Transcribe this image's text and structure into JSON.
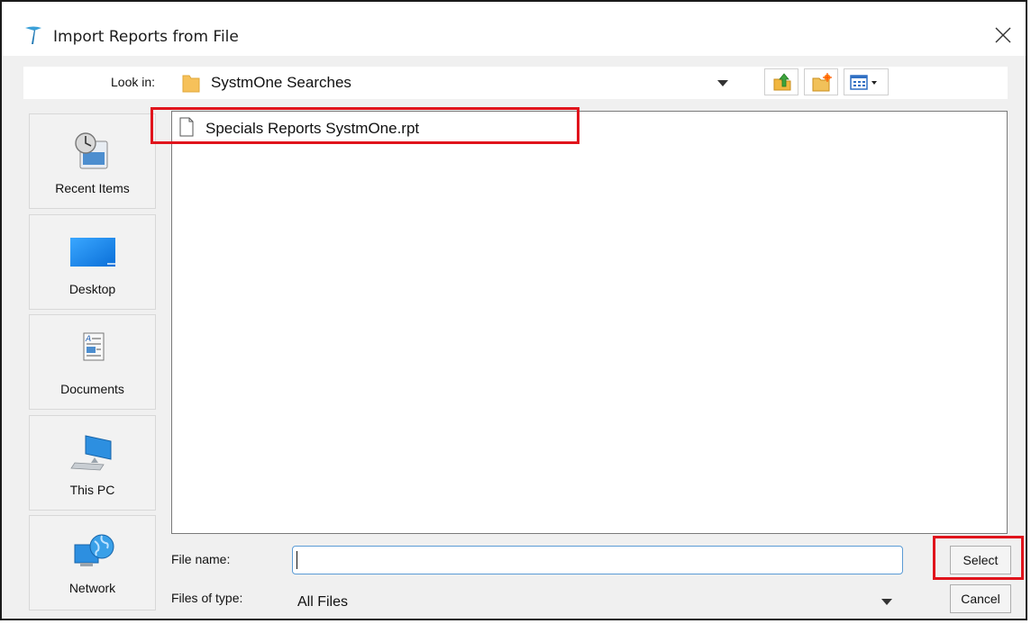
{
  "window": {
    "title": "Import Reports from File"
  },
  "lookin": {
    "label": "Look in:",
    "value": "SystmOne Searches"
  },
  "toolbar": {
    "icons": [
      "up-folder-icon",
      "new-folder-icon",
      "view-menu-icon"
    ]
  },
  "places": [
    {
      "label": "Recent Items",
      "icon": "recent-items-icon"
    },
    {
      "label": "Desktop",
      "icon": "desktop-icon"
    },
    {
      "label": "Documents",
      "icon": "documents-icon"
    },
    {
      "label": "This PC",
      "icon": "this-pc-icon"
    },
    {
      "label": "Network",
      "icon": "network-icon"
    }
  ],
  "files": [
    {
      "name": "Specials Reports SystmOne.rpt",
      "icon": "document-icon"
    }
  ],
  "filename": {
    "label": "File name:",
    "value": ""
  },
  "filetype": {
    "label": "Files of type:",
    "value": "All Files"
  },
  "buttons": {
    "select": "Select",
    "cancel": "Cancel"
  },
  "colors": {
    "highlight": "#e0141c",
    "accent": "#5b9bd5",
    "dialog_bg": "#f0f0f0"
  }
}
